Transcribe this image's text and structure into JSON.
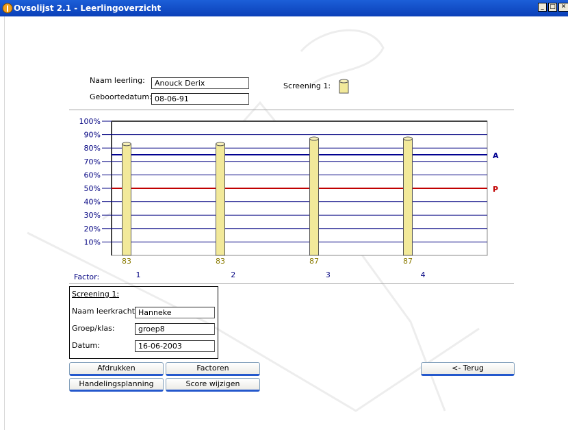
{
  "window": {
    "title": "Ovsolijst 2.1 - Leerlingoverzicht",
    "minimize_glyph": "_",
    "maximize_glyph": "□",
    "close_glyph": "✕"
  },
  "student": {
    "name_label": "Naam leerling:",
    "name_value": "Anouck Derix",
    "dob_label": "Geboortedatum:",
    "dob_value": "08-06-91"
  },
  "legend": {
    "screening_label": "Screening 1:"
  },
  "chart_data": {
    "type": "bar",
    "categories": [
      "1",
      "2",
      "3",
      "4"
    ],
    "values": [
      83,
      83,
      87,
      87
    ],
    "value_labels": [
      "83",
      "83",
      "87",
      "87"
    ],
    "y_ticks": [
      "10%",
      "20%",
      "30%",
      "40%",
      "50%",
      "60%",
      "70%",
      "80%",
      "90%",
      "100%"
    ],
    "ylim": [
      0,
      100
    ],
    "xlabel": "Factor:",
    "reference_lines": [
      {
        "label": "A",
        "value": 75,
        "color": "#000090"
      },
      {
        "label": "P",
        "value": 50,
        "color": "#c00000"
      }
    ],
    "grid": true,
    "grid_color": "#000080",
    "bar_color": "#f2e99a"
  },
  "screening": {
    "title": "Screening 1:",
    "teacher_label": "Naam leerkracht:",
    "teacher_value": "Hanneke",
    "group_label": "Groep/klas:",
    "group_value": "groep8",
    "date_label": "Datum:",
    "date_value": "16-06-2003"
  },
  "buttons": {
    "print": "Afdrukken",
    "factors": "Factoren",
    "planning": "Handelingsplanning",
    "edit_score": "Score wijzigen",
    "back": "<- Terug"
  },
  "colors": {
    "titlebar": "#0a3fb8",
    "axis_text": "#000080",
    "value_text": "#8a7a00"
  },
  "icons": [
    "app-icon",
    "cylinder-legend-icon"
  ]
}
